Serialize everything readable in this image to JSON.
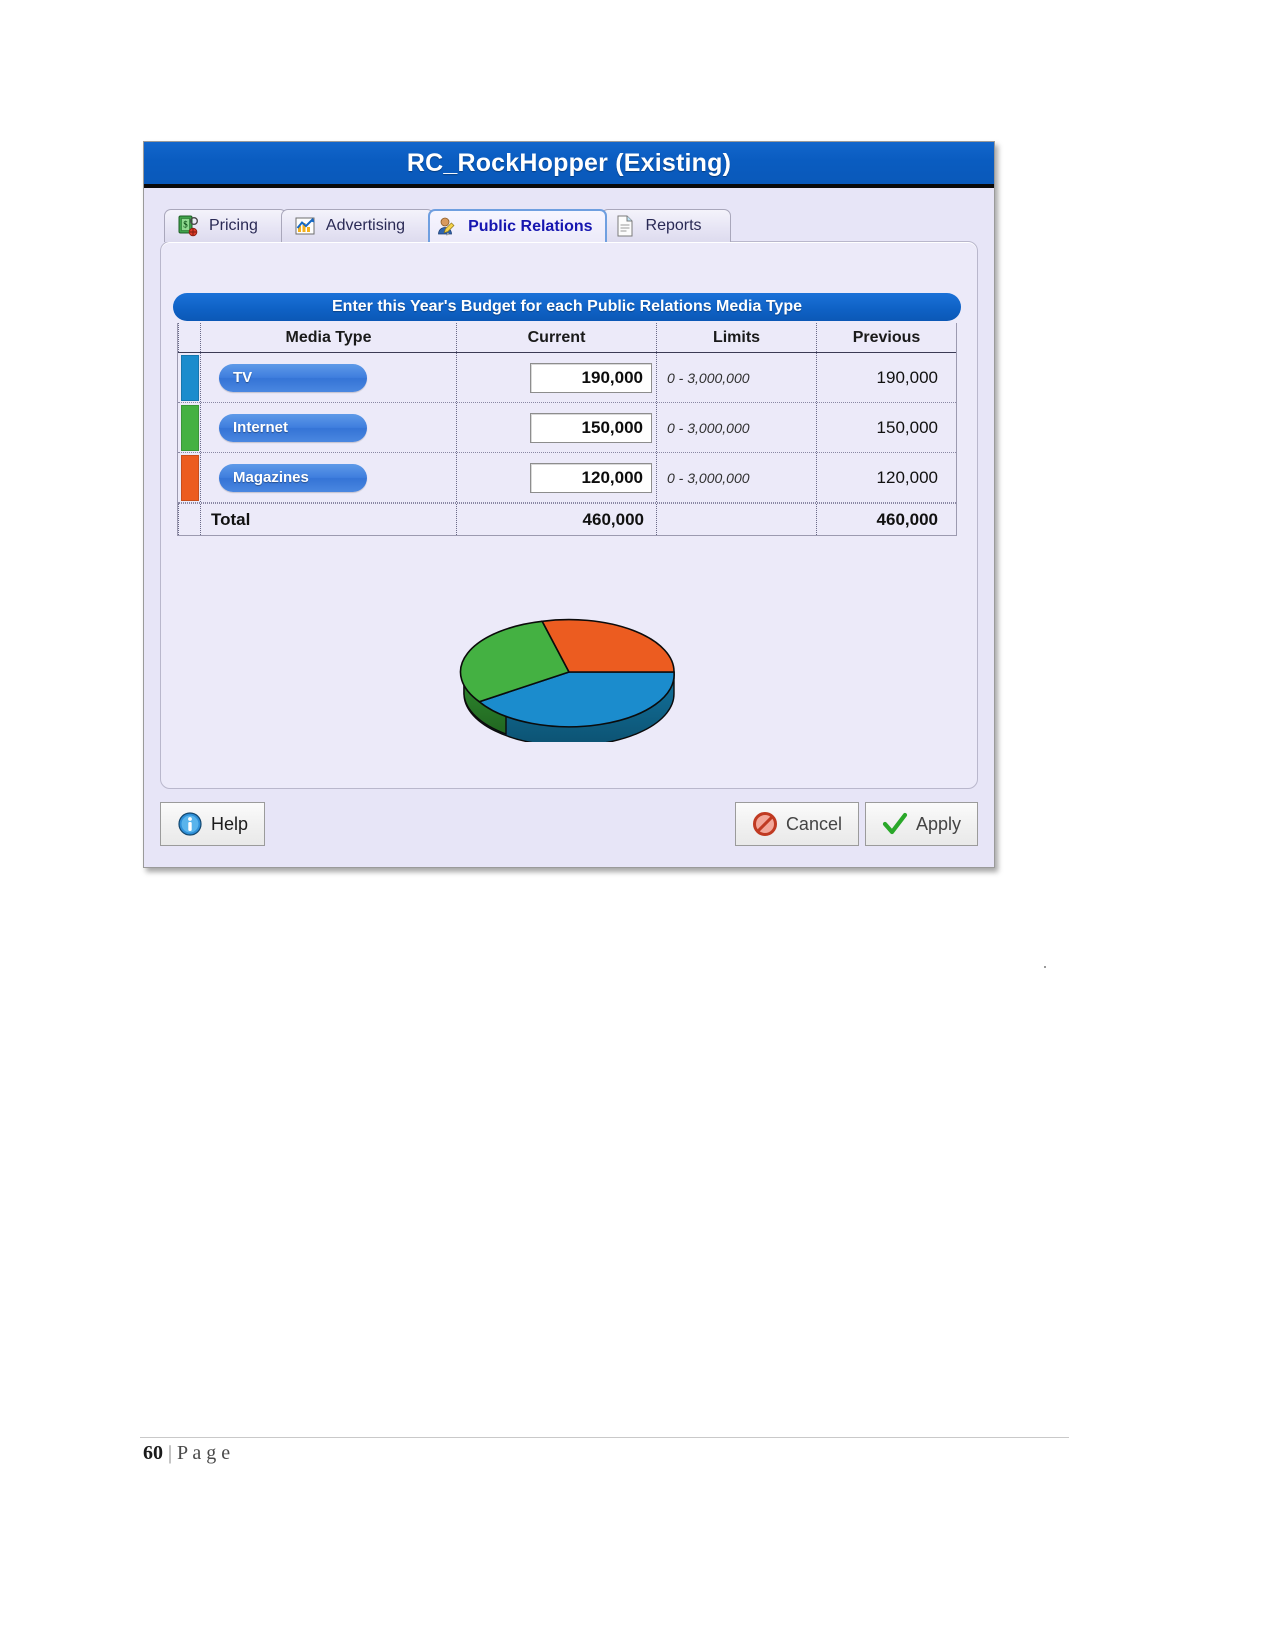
{
  "window": {
    "title": "RC_RockHopper (Existing)"
  },
  "tabs": [
    {
      "label": "Pricing",
      "icon": "money-gear-icon",
      "active": false
    },
    {
      "label": "Advertising",
      "icon": "bar-chart-icon",
      "active": false
    },
    {
      "label": "Public Relations",
      "icon": "person-pencil-icon",
      "active": true
    },
    {
      "label": "Reports",
      "icon": "document-icon",
      "active": false
    }
  ],
  "panel": {
    "banner": "Enter this Year's Budget for each Public Relations Media Type",
    "table": {
      "headers": [
        "Media Type",
        "Current",
        "Limits",
        "Previous"
      ],
      "rows": [
        {
          "media": "TV",
          "swatch": "#1b8ccd",
          "current": "190,000",
          "limits": "0 - 3,000,000",
          "previous": "190,000"
        },
        {
          "media": "Internet",
          "swatch": "#44b142",
          "current": "150,000",
          "limits": "0 - 3,000,000",
          "previous": "150,000"
        },
        {
          "media": "Magazines",
          "swatch": "#ec5c20",
          "current": "120,000",
          "limits": "0 - 3,000,000",
          "previous": "120,000"
        }
      ],
      "total": {
        "label": "Total",
        "current": "460,000",
        "limits": "",
        "previous": "460,000"
      }
    }
  },
  "chart_data": {
    "type": "pie",
    "title": "",
    "labels": [
      "TV",
      "Internet",
      "Magazines"
    ],
    "values": [
      190000,
      150000,
      120000
    ],
    "colors": [
      "#1b8ccd",
      "#44b142",
      "#ec5c20"
    ],
    "total": 460000,
    "legend": "none",
    "style": "3d"
  },
  "buttons": {
    "help": {
      "label": "Help",
      "icon": "info-icon"
    },
    "cancel": {
      "label": "Cancel",
      "icon": "no-entry-icon"
    },
    "apply": {
      "label": "Apply",
      "icon": "checkmark-icon"
    }
  },
  "footer": {
    "page_number": "60",
    "separator": " | ",
    "page_word": "P a g e"
  }
}
